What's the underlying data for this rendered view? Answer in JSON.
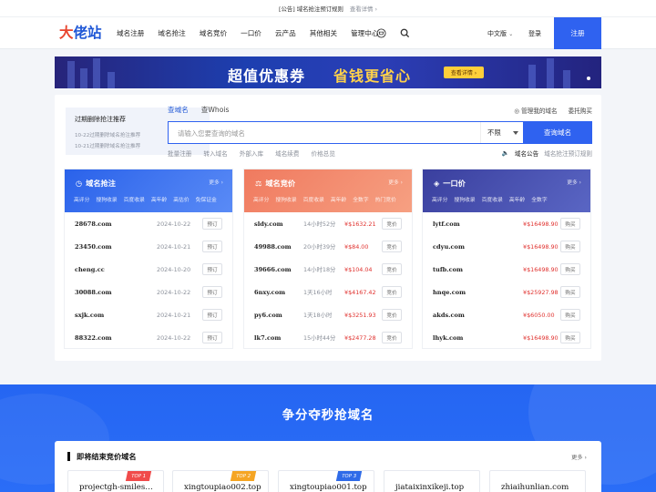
{
  "notice": {
    "text": "[公告] 域名抢注预订规则",
    "more": "查看详情 ›"
  },
  "nav": {
    "logo_a": "大",
    "logo_b": "佬站",
    "menu": [
      "域名注册",
      "域名抢注",
      "域名竞价",
      "一口价",
      "云产品",
      "其他相关",
      "管理中心"
    ],
    "lang": "中文版",
    "login": "登录",
    "register": "注册"
  },
  "banner": {
    "text_white": "超值优惠券",
    "text_yellow": "省钱更省心",
    "button": "查看详情 ›"
  },
  "search": {
    "dropped_title": "过期删除抢注推荐",
    "dropped_items": [
      "10-22过期删除域名抢注推荐",
      "10-21过期删除域名抢注推荐"
    ],
    "tabs": [
      "查域名",
      "查Whois"
    ],
    "links": [
      "管理我的域名",
      "委托购买"
    ],
    "placeholder": "请输入您要查询的域名",
    "select": "不限",
    "button": "查询域名",
    "quick_links": [
      "批量注册",
      "转入域名",
      "外部入库",
      "域名续费",
      "价格总览"
    ],
    "notice_label": "域名公告",
    "notice_text": "域名抢注预订规则"
  },
  "cards": [
    {
      "title": "域名抢注",
      "more": "更多 ›",
      "tabs": [
        "高评分",
        "搜狗收录",
        "百度收录",
        "高年龄",
        "高估价",
        "免保证金"
      ],
      "rows": [
        {
          "domain": "28678.com",
          "info": "2024-10-22",
          "btn": "预订"
        },
        {
          "domain": "23450.com",
          "info": "2024-10-21",
          "btn": "预订"
        },
        {
          "domain": "cheng.cc",
          "info": "2024-10-20",
          "btn": "预订"
        },
        {
          "domain": "30088.com",
          "info": "2024-10-22",
          "btn": "预订"
        },
        {
          "domain": "sxjk.com",
          "info": "2024-10-21",
          "btn": "预订"
        },
        {
          "domain": "88322.com",
          "info": "2024-10-22",
          "btn": "预订"
        }
      ]
    },
    {
      "title": "域名竞价",
      "more": "更多 ›",
      "tabs": [
        "高评分",
        "搜狗收录",
        "百度收录",
        "高年龄",
        "全数字",
        "热门竞价"
      ],
      "rows": [
        {
          "domain": "sldy.com",
          "time": "14小时52分",
          "price": "¥$1632.21",
          "btn": "竞价"
        },
        {
          "domain": "49988.com",
          "time": "20小时39分",
          "price": "¥$84.00",
          "btn": "竞价"
        },
        {
          "domain": "39666.com",
          "time": "14小时18分",
          "price": "¥$104.04",
          "btn": "竞价"
        },
        {
          "domain": "6nxy.com",
          "time": "1天16小时",
          "price": "¥$4167.42",
          "btn": "竞价"
        },
        {
          "domain": "py6.com",
          "time": "1天18小时",
          "price": "¥$3251.93",
          "btn": "竞价"
        },
        {
          "domain": "lk7.com",
          "time": "15小时44分",
          "price": "¥$2477.28",
          "btn": "竞价"
        }
      ]
    },
    {
      "title": "一口价",
      "more": "更多 ›",
      "tabs": [
        "高评分",
        "搜狗收录",
        "百度收录",
        "高年龄",
        "全数字"
      ],
      "rows": [
        {
          "domain": "lytf.com",
          "price": "¥$16498.90",
          "btn": "购买"
        },
        {
          "domain": "cdyu.com",
          "price": "¥$16498.90",
          "btn": "购买"
        },
        {
          "domain": "tufb.com",
          "price": "¥$16498.90",
          "btn": "购买"
        },
        {
          "domain": "hnqe.com",
          "price": "¥$25927.98",
          "btn": "购买"
        },
        {
          "domain": "akds.com",
          "price": "¥$6050.00",
          "btn": "购买"
        },
        {
          "domain": "lhyk.com",
          "price": "¥$16498.90",
          "btn": "购买"
        }
      ]
    }
  ],
  "section": {
    "title": "争分夺秒抢域名"
  },
  "ending": {
    "title": "即将结束竞价域名",
    "more": "更多 ›",
    "items": [
      {
        "domain": "projectgh-smiles…",
        "tag": "TOP 1"
      },
      {
        "domain": "xingtoupiao002.top",
        "tag": "TOP 2"
      },
      {
        "domain": "xingtoupiao001.top",
        "tag": "TOP 3"
      },
      {
        "domain": "jiataixinxikeji.top",
        "tag": ""
      },
      {
        "domain": "zhiaihunlian.com",
        "tag": ""
      }
    ]
  },
  "colors": {
    "primary": "#2f62f0",
    "card1": "#2a62ea",
    "card2": "#f07a5f",
    "card3": "#3a3f9e",
    "price": "#e0302d",
    "top1": "#f04b4b",
    "top2": "#f5a524",
    "top3": "#2f6be8"
  }
}
